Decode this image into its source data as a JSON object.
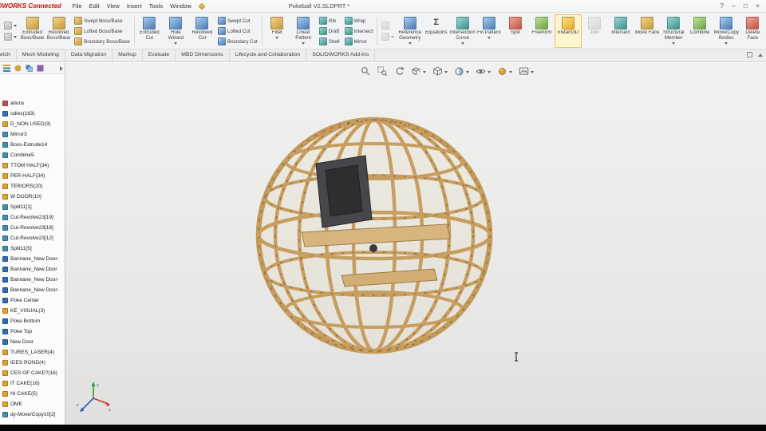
{
  "titlebar": {
    "brand": "SOLIDWORKS Connected",
    "menus": [
      "File",
      "Edit",
      "View",
      "Insert",
      "Tools",
      "Window"
    ],
    "doc_title": "Pokeball V2.SLDPRT *",
    "controls": [
      "?",
      "–",
      "□",
      "×"
    ]
  },
  "glyphs": {
    "sigma": "Σ"
  },
  "ribbon": {
    "large": [
      "Extruded Boss/Base",
      "Revolved Boss/Base",
      "Extruded Cut",
      "Hole Wizard",
      "Revolved Cut",
      "Fillet",
      "Linear Pattern",
      "Reference Geometry",
      "Equations",
      "Intersection Curve",
      "Fill Pattern",
      "Split",
      "Freeform",
      "Instant3D",
      "Join",
      "Intersect",
      "Move Face",
      "Structural Member",
      "Combine",
      "Move/Copy Bodies",
      "Delete Face"
    ],
    "small": [
      "Swept Boss/Base",
      "Lofted Boss/Base",
      "Boundary Boss/Base",
      "Swept Cut",
      "Lofted Cut",
      "Boundary Cut",
      "Rib",
      "Draft",
      "Shell",
      "Wrap",
      "Intersect",
      "Mirror"
    ]
  },
  "tabs": [
    "Sketch",
    "Mesh Modeling",
    "Data Migration",
    "Markup",
    "Evaluate",
    "MBD Dimensions",
    "Lifecycle and Collaboration",
    "SOLIDWORKS Add-Ins"
  ],
  "tree": {
    "items": [
      {
        "label": "ations",
        "color": "#c0504d"
      },
      {
        "label": "odies(163)",
        "color": "#2f6fb5"
      },
      {
        "label": "D_NON USED(3)",
        "color": "#dfa32b"
      },
      {
        "label": "Mirror3",
        "color": "#3f8fb0"
      },
      {
        "label": "Boss-Extrude14",
        "color": "#3f8fb0"
      },
      {
        "label": "Combine5",
        "color": "#3f8fb0"
      },
      {
        "label": "TTOM HALF(34)",
        "color": "#dfa32b"
      },
      {
        "label": "PER HALF(34)",
        "color": "#dfa32b"
      },
      {
        "label": "TERIORS(20)",
        "color": "#dfa32b"
      },
      {
        "label": "W DOOR(10)",
        "color": "#dfa32b"
      },
      {
        "label": "Split11[1]",
        "color": "#3f8fb0"
      },
      {
        "label": "Cut-Revolve23[19]",
        "color": "#3f8fb0"
      },
      {
        "label": "Cut-Revolve23[18]",
        "color": "#3f8fb0"
      },
      {
        "label": "Cut-Revolve23[12]",
        "color": "#3f8fb0"
      },
      {
        "label": "Split11[5]",
        "color": "#3f8fb0"
      },
      {
        "label": "Bannane_New Door-",
        "color": "#2f6fb5"
      },
      {
        "label": "Bannane_New Door",
        "color": "#2f6fb5"
      },
      {
        "label": "Bannane_New Door-",
        "color": "#2f6fb5"
      },
      {
        "label": "Bannane_New Door-",
        "color": "#2f6fb5"
      },
      {
        "label": "Poke Center",
        "color": "#2f6fb5"
      },
      {
        "label": "KE_VISUAL(3)",
        "color": "#dfa32b"
      },
      {
        "label": "Poke Bottom",
        "color": "#2f6fb5"
      },
      {
        "label": "Poke Top",
        "color": "#2f6fb5"
      },
      {
        "label": "New Door",
        "color": "#2f6fb5"
      },
      {
        "label": "TURES_LASER(4)",
        "color": "#dfa32b"
      },
      {
        "label": "IDES ROND(4)",
        "color": "#dfa32b"
      },
      {
        "label": "CES OF CAKE?(16)",
        "color": "#dfa32b"
      },
      {
        "label": "IT CAKE(16)",
        "color": "#dfa32b"
      },
      {
        "label": "NI CAKE(5)",
        "color": "#dfa32b"
      },
      {
        "label": "OME",
        "color": "#dfa32b"
      },
      {
        "label": "dy-Move/Copy10[2]",
        "color": "#3f8fb0"
      }
    ]
  },
  "headsup_icons": [
    "zoom-fit",
    "zoom-area",
    "previous-view",
    "section-view",
    "view-orientation",
    "display-style",
    "hide-show-items",
    "edit-appearance",
    "apply-scene"
  ],
  "panel_icons": [
    "featuremanager",
    "propertymanager",
    "configurationmanager",
    "dimxpertmanager"
  ],
  "colors": {
    "highlight": "#e2c95f",
    "wood": "#c79e5f",
    "viewport_bg": "#ececec"
  }
}
